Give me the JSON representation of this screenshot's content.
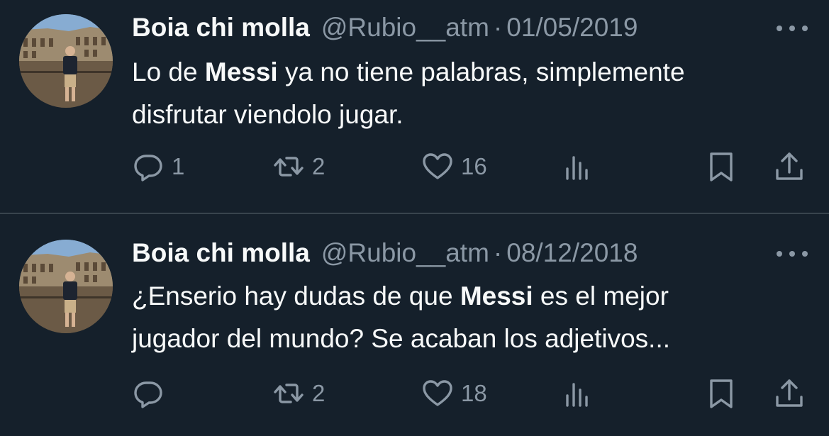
{
  "tweets": [
    {
      "name": "Boia chi molla",
      "handle": "@Rubio__atm",
      "separator": "·",
      "date": "01/05/2019",
      "text_line1_a": "Lo de ",
      "text_line1_bold": "Messi",
      "text_line1_b": " ya no tiene palabras, simplemente",
      "text_line2": "disfrutar viendolo jugar.",
      "replies": "1",
      "retweets": "2",
      "likes": "16"
    },
    {
      "name": "Boia chi molla",
      "handle": "@Rubio__atm",
      "separator": "·",
      "date": "08/12/2018",
      "text_line1_a": "¿Enserio hay dudas de que ",
      "text_line1_bold": "Messi",
      "text_line1_b": " es el mejor",
      "text_line2": "jugador del mundo? Se acaban los adjetivos...",
      "replies": "",
      "retweets": "2",
      "likes": "18"
    }
  ],
  "icons": {
    "reply": "reply-icon",
    "retweet": "retweet-icon",
    "like": "heart-icon",
    "views": "views-icon",
    "bookmark": "bookmark-icon",
    "share": "share-icon",
    "more": "more-icon"
  },
  "colors": {
    "background": "#15202b",
    "text": "#f7f9f9",
    "muted": "#8b98a5",
    "divider": "#38444d"
  }
}
